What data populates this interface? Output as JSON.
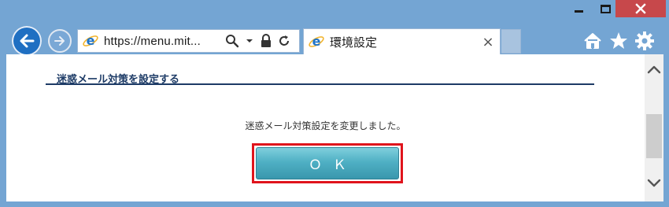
{
  "window": {
    "minimize_icon": "minimize-icon",
    "maximize_icon": "maximize-icon",
    "close_icon": "close-icon",
    "close_color": "#c7484b"
  },
  "nav": {
    "back_icon": "back-arrow-icon",
    "forward_icon": "forward-arrow-icon"
  },
  "address_bar": {
    "url": "https://menu.mit...",
    "icons": [
      "ie-logo-icon",
      "search-icon",
      "dropdown-icon",
      "lock-icon",
      "refresh-icon"
    ]
  },
  "tab": {
    "title": "環境設定",
    "close_label": "×"
  },
  "toolbar": {
    "icons": [
      "home-icon",
      "favorites-star-icon",
      "settings-gear-icon"
    ]
  },
  "page": {
    "section_title": "迷惑メール対策を設定する",
    "message": "迷惑メール対策設定を変更しました。",
    "ok_label": "ＯＫ",
    "highlight_color": "#e0141c",
    "button_color": "#4fb0c4",
    "heading_color": "#1d3b66"
  },
  "scrollbar": {
    "up_icon": "chevron-up-icon",
    "down_icon": "chevron-down-icon"
  }
}
